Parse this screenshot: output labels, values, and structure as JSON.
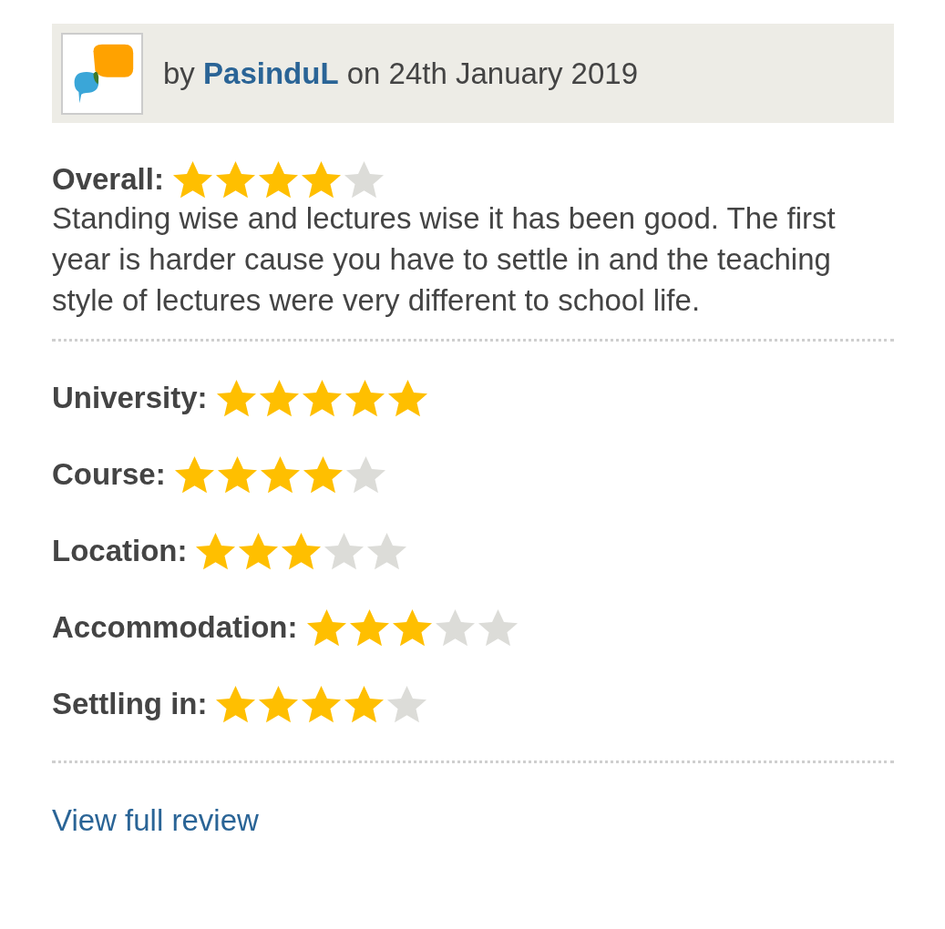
{
  "header": {
    "prefix": "by",
    "author": "PasinduL",
    "date": "on 24th January 2019"
  },
  "overall": {
    "label": "Overall:",
    "stars": 4
  },
  "text": "Standing wise and lectures wise it has been good. The first year is harder cause you have to settle in and the teaching style of lectures were very different to school life.",
  "ratings": [
    {
      "label": "University:",
      "stars": 5
    },
    {
      "label": "Course:",
      "stars": 4
    },
    {
      "label": "Location:",
      "stars": 3
    },
    {
      "label": "Accommodation:",
      "stars": 3
    },
    {
      "label": "Settling in:",
      "stars": 4
    }
  ],
  "link": "View full review"
}
